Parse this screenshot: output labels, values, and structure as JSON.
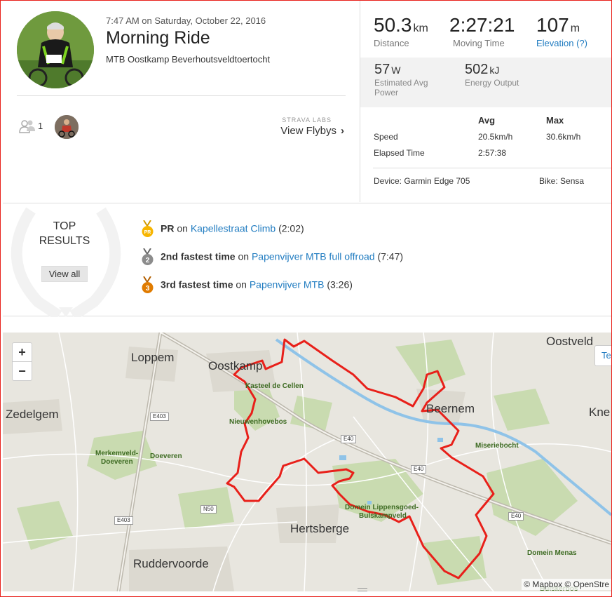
{
  "activity": {
    "datetime": "7:47 AM on Saturday, October 22, 2016",
    "title": "Morning Ride",
    "description": "MTB Oostkamp Beverhoutsveldtoertocht"
  },
  "social": {
    "athlete_count": "1",
    "labs_label": "STRAVA LABS",
    "flyby_label": "View Flybys",
    "flyby_chevron": "›"
  },
  "stats": {
    "distance": {
      "value": "50.3",
      "unit": "km",
      "label": "Distance"
    },
    "moving_time": {
      "value": "2:27:21",
      "label": "Moving Time"
    },
    "elevation": {
      "value": "107",
      "unit": "m",
      "label": "Elevation (?)"
    },
    "power": {
      "value": "57",
      "unit": "W",
      "label_line1": "Estimated Avg",
      "label_line2": "Power"
    },
    "energy": {
      "value": "502",
      "unit": "kJ",
      "label": "Energy Output"
    },
    "table": {
      "header_avg": "Avg",
      "header_max": "Max",
      "speed_label": "Speed",
      "speed_avg": "20.5km/h",
      "speed_max": "30.6km/h",
      "elapsed_label": "Elapsed Time",
      "elapsed_avg": "2:57:38"
    },
    "device": "Device: Garmin Edge 705",
    "bike": "Bike: Sensa"
  },
  "top_results": {
    "title_line1": "TOP",
    "title_line2": "RESULTS",
    "view_all": "View all",
    "items": [
      {
        "medal": "PR",
        "rank": "PR",
        "on": "on",
        "segment": "Kapellestraat Climb",
        "time": "(2:02)",
        "color": "#f7b500"
      },
      {
        "medal": "2",
        "rank": "2nd fastest time",
        "on": "on",
        "segment": "Papenvijver MTB full offroad",
        "time": "(7:47)",
        "color": "#8c8c8c"
      },
      {
        "medal": "3",
        "rank": "3rd fastest time",
        "on": "on",
        "segment": "Papenvijver MTB",
        "time": "(3:26)",
        "color": "#e07b00"
      }
    ]
  },
  "map": {
    "zoom_in": "+",
    "zoom_out": "−",
    "terrain": "Te",
    "attribution": "© Mapbox © OpenStre",
    "places": {
      "loppem": "Loppem",
      "oostkamp": "Oostkamp",
      "oostveld": "Oostveld",
      "zedelgem": "Zedelgem",
      "beernem": "Beernem",
      "kne": "Kne",
      "hertsberge": "Hertsberge",
      "ruddervoorde": "Ruddervoorde",
      "kasteel": "Kasteel de Cellen",
      "nieuwenhovebos": "Nieuwenhovebos",
      "merkemveld": "Merkemveld-",
      "doeveren_a": "Doeveren",
      "doeveren_b": "Doeveren",
      "miseriebocht": "Miseriebocht",
      "domein_line1": "Domein Lippensgoed-",
      "domein_line2": "Bulskampveld",
      "domein_menas": "Domein Menas",
      "bulskerbos": "Bulskerbos"
    },
    "roads": {
      "e403_a": "E403",
      "e403_b": "E403",
      "e40_a": "E40",
      "e40_b": "E40",
      "e40_c": "E40",
      "n50": "N50"
    },
    "route_color": "#e8201a"
  }
}
